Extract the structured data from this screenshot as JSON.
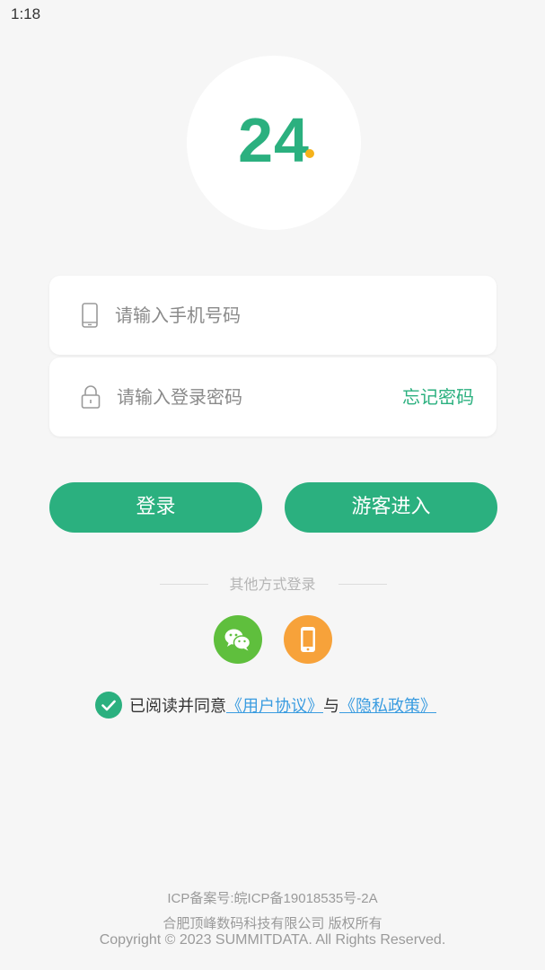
{
  "status_bar": {
    "time": "1:18"
  },
  "logo": {
    "text": "24"
  },
  "form": {
    "phone_placeholder": "请输入手机号码",
    "password_placeholder": "请输入登录密码",
    "forgot_password": "忘记密码"
  },
  "buttons": {
    "login": "登录",
    "guest": "游客进入"
  },
  "other_login": {
    "label": "其他方式登录"
  },
  "agreement": {
    "prefix": "已阅读并同意",
    "user_agreement": "《用户协议》",
    "connector": "与",
    "privacy_policy": "《隐私政策》"
  },
  "footer": {
    "icp": "ICP备案号:皖ICP备19018535号-2A",
    "company": "合肥顶峰数码科技有限公司 版权所有",
    "copyright": "Copyright © 2023 SUMMITDATA. All Rights Reserved."
  },
  "colors": {
    "accent": "#2bb07f",
    "wechat": "#5fbf3d",
    "phone_login": "#f7a23a",
    "link": "#3a9ce0",
    "logo_dot": "#f5b21a"
  },
  "icons": [
    "phone-icon",
    "lock-icon",
    "wechat-icon",
    "mobile-icon",
    "check-icon"
  ]
}
